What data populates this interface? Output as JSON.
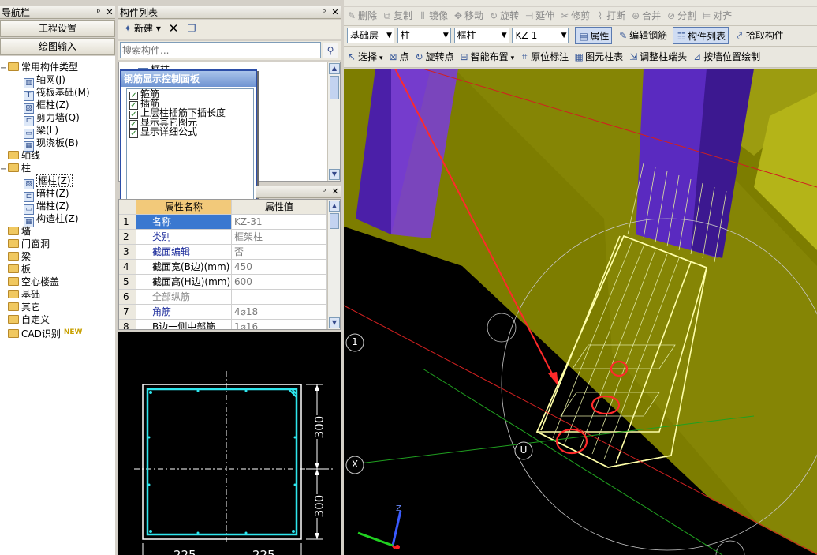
{
  "nav": {
    "title": "导航栏",
    "buttons": [
      "工程设置",
      "绘图输入"
    ],
    "tree": [
      {
        "label": "常用构件类型",
        "kind": "folder",
        "expanded": true
      },
      {
        "label": "轴网(J)",
        "kind": "child"
      },
      {
        "label": "筏板基础(M)",
        "kind": "child"
      },
      {
        "label": "框柱(Z)",
        "kind": "child"
      },
      {
        "label": "剪力墙(Q)",
        "kind": "child"
      },
      {
        "label": "梁(L)",
        "kind": "child"
      },
      {
        "label": "现浇板(B)",
        "kind": "child"
      },
      {
        "label": "轴线",
        "kind": "folder"
      },
      {
        "label": "柱",
        "kind": "folder",
        "expanded": true
      },
      {
        "label": "框柱(Z)",
        "kind": "child",
        "selected": true
      },
      {
        "label": "暗柱(Z)",
        "kind": "child"
      },
      {
        "label": "端柱(Z)",
        "kind": "child"
      },
      {
        "label": "构造柱(Z)",
        "kind": "child"
      },
      {
        "label": "墙",
        "kind": "folder"
      },
      {
        "label": "门窗洞",
        "kind": "folder"
      },
      {
        "label": "梁",
        "kind": "folder"
      },
      {
        "label": "板",
        "kind": "folder"
      },
      {
        "label": "空心楼盖",
        "kind": "folder"
      },
      {
        "label": "基础",
        "kind": "folder"
      },
      {
        "label": "其它",
        "kind": "folder"
      },
      {
        "label": "自定义",
        "kind": "folder"
      },
      {
        "label": "CAD识别",
        "kind": "folder",
        "badge": "NEW"
      }
    ]
  },
  "component_list": {
    "title": "构件列表",
    "new_label": "新建",
    "search_placeholder": "搜索构件...",
    "first_item": "框柱"
  },
  "rebar_panel": {
    "title": "钢筋显示控制面板",
    "options": [
      "箍筋",
      "插筋",
      "上层柱插筋下插长度",
      "显示其它图元",
      "显示详细公式"
    ]
  },
  "properties": {
    "headers": [
      "属性名称",
      "属性值"
    ],
    "rows": [
      {
        "num": "1",
        "name": "名称",
        "value": "KZ-31"
      },
      {
        "num": "2",
        "name": "类别",
        "value": "框架柱"
      },
      {
        "num": "3",
        "name": "截面编辑",
        "value": "否"
      },
      {
        "num": "4",
        "name": "截面宽(B边)(mm)",
        "value": "450"
      },
      {
        "num": "5",
        "name": "截面高(H边)(mm)",
        "value": "600"
      },
      {
        "num": "6",
        "name": "全部纵筋",
        "value": ""
      },
      {
        "num": "7",
        "name": "角筋",
        "value": "4⌀18"
      },
      {
        "num": "8",
        "name": "B边一侧中部筋",
        "value": "1⌀16"
      }
    ]
  },
  "section": {
    "dim_top": "300",
    "dim_bottom": "300",
    "dim_bottom_left": "225",
    "dim_bottom_right": "225"
  },
  "toolbar1": [
    "删除",
    "复制",
    "镜像",
    "移动",
    "旋转",
    "延伸",
    "修剪",
    "打断",
    "合并",
    "分割",
    "对齐"
  ],
  "toolbar2": {
    "floor": "基础层",
    "category": "柱",
    "type": "框柱",
    "component": "KZ-1",
    "buttons": [
      "属性",
      "编辑钢筋",
      "构件列表",
      "拾取构件"
    ]
  },
  "toolbar3": [
    "选择",
    "点",
    "旋转点",
    "智能布置",
    "原位标注",
    "图元柱表",
    "调整柱端头",
    "按墙位置绘制"
  ],
  "viewport": {
    "axis_labels": [
      "1",
      "X",
      "U"
    ],
    "axis_z": "Z"
  },
  "colors": {
    "cad_bg": "#000000",
    "slab": "#7d7d00",
    "column": "#4b1fa8",
    "annotation": "#ff2a2a",
    "rebar_cyan": "#2ee6ee"
  }
}
